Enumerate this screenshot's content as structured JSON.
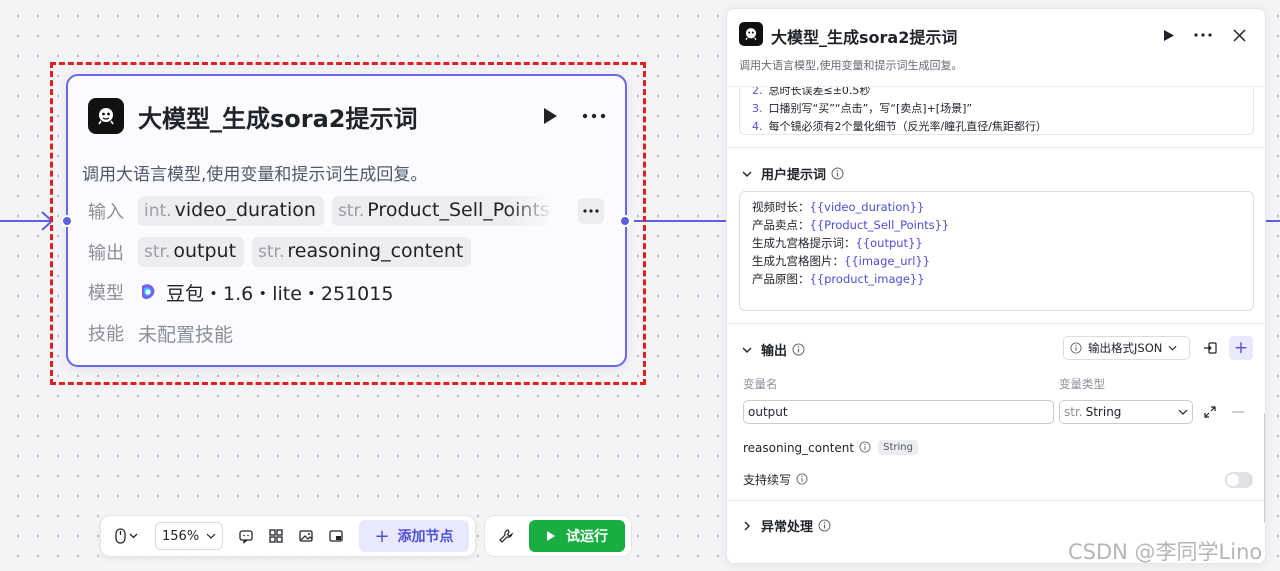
{
  "node": {
    "title": "大模型_生成sora2提示词",
    "description": "调用大语言模型,使用变量和提示词生成回复。",
    "input_label": "输入",
    "inputs": [
      {
        "type": "int.",
        "name": "video_duration"
      },
      {
        "type": "str.",
        "name": "Product_Sell_Points"
      }
    ],
    "output_label": "输出",
    "outputs": [
      {
        "type": "str.",
        "name": "output"
      },
      {
        "type": "str.",
        "name": "reasoning_content"
      }
    ],
    "model_label": "模型",
    "model": "豆包・1.6・lite・251015",
    "skill_label": "技能",
    "skill_value": "未配置技能"
  },
  "toolbar": {
    "zoom": "156%",
    "add_node": "添加节点",
    "run": "试运行"
  },
  "panel": {
    "title": "大模型_生成sora2提示词",
    "description": "调用大语言模型,使用变量和提示词生成回复。",
    "system_lines": [
      {
        "num": "2.",
        "text": "总时长误差≤±0.5秒"
      },
      {
        "num": "3.",
        "text": "口播别写“买”“点击”，写“[卖点]+[场景]”"
      },
      {
        "num": "4.",
        "text": "每个镜必须有2个量化细节（反光率/瞳孔直径/焦距都行）"
      }
    ],
    "user_prompt_title": "用户提示词",
    "user_prompt_lines": [
      {
        "label": "视频时长：",
        "var": "{{video_duration}}"
      },
      {
        "label": "产品卖点：",
        "var": "{{Product_Sell_Points}}"
      },
      {
        "label": "生成九宫格提示词：",
        "var": "{{output}}"
      },
      {
        "label": "生成九宫格图片：",
        "var": "{{image_url}}"
      },
      {
        "label": "产品原图：",
        "var": "{{product_image}}"
      }
    ],
    "output_title": "输出",
    "output_format": "输出格式JSON",
    "col_var_name": "变量名",
    "col_var_type": "变量类型",
    "output_var_name": "output",
    "output_var_type_prefix": "str.",
    "output_var_type": "String",
    "reasoning_name": "reasoning_content",
    "reasoning_type": "String",
    "continue_label": "支持续写",
    "continue_enabled": false,
    "exception_title": "异常处理"
  },
  "watermark": "CSDN @李同学Lino",
  "colors": {
    "accent": "#5b5fe0",
    "selection": "#e02020",
    "run": "#1aae42"
  }
}
